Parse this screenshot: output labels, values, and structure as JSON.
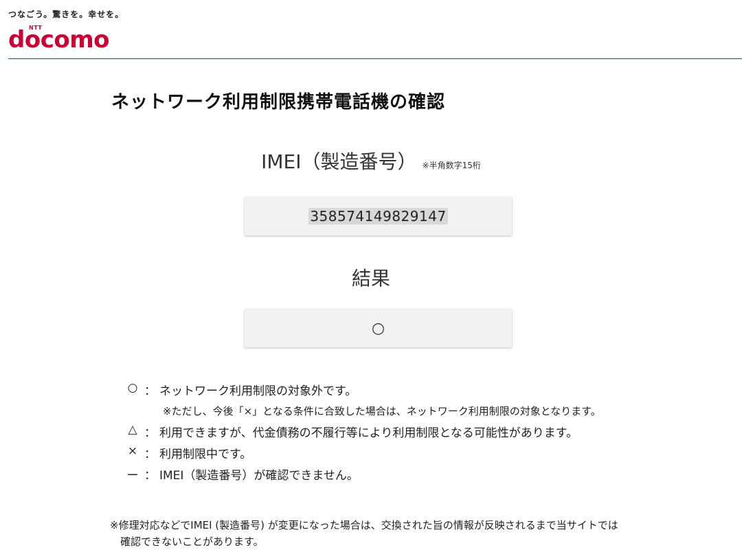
{
  "header": {
    "tagline": "つなごう。驚きを。幸せを。",
    "logo_ntt": "NTT",
    "logo_text": "docomo"
  },
  "page": {
    "title": "ネットワーク利用制限携帯電話機の確認"
  },
  "imei": {
    "heading": "IMEI（製造番号）",
    "note": "※半角数字15桁",
    "value": "358574149829147"
  },
  "result": {
    "heading": "結果",
    "value": "○"
  },
  "legend": [
    {
      "symbol": "○",
      "colon": "：",
      "text": "ネットワーク利用制限の対象外です。"
    },
    {
      "symbol": "△",
      "colon": "：",
      "text": "利用できますが、代金債務の不履行等により利用制限となる可能性があります。"
    },
    {
      "symbol": "×",
      "colon": "：",
      "text": "利用制限中です。"
    },
    {
      "symbol": "ー",
      "colon": "：",
      "text": "IMEI（製造番号）が確認できません。"
    }
  ],
  "legend_sub": "※ただし、今後「×」となる条件に合致した場合は、ネットワーク利用制限の対象となります。",
  "footnote": {
    "line1": "※修理対応などでIMEI (製造番号) が変更になった場合は、交換された旨の情報が反映されるまで当サイトでは",
    "line2": "確認できないことがあります。"
  },
  "colors": {
    "brand": "#cc0033",
    "box_bg": "#f2f2f2"
  }
}
